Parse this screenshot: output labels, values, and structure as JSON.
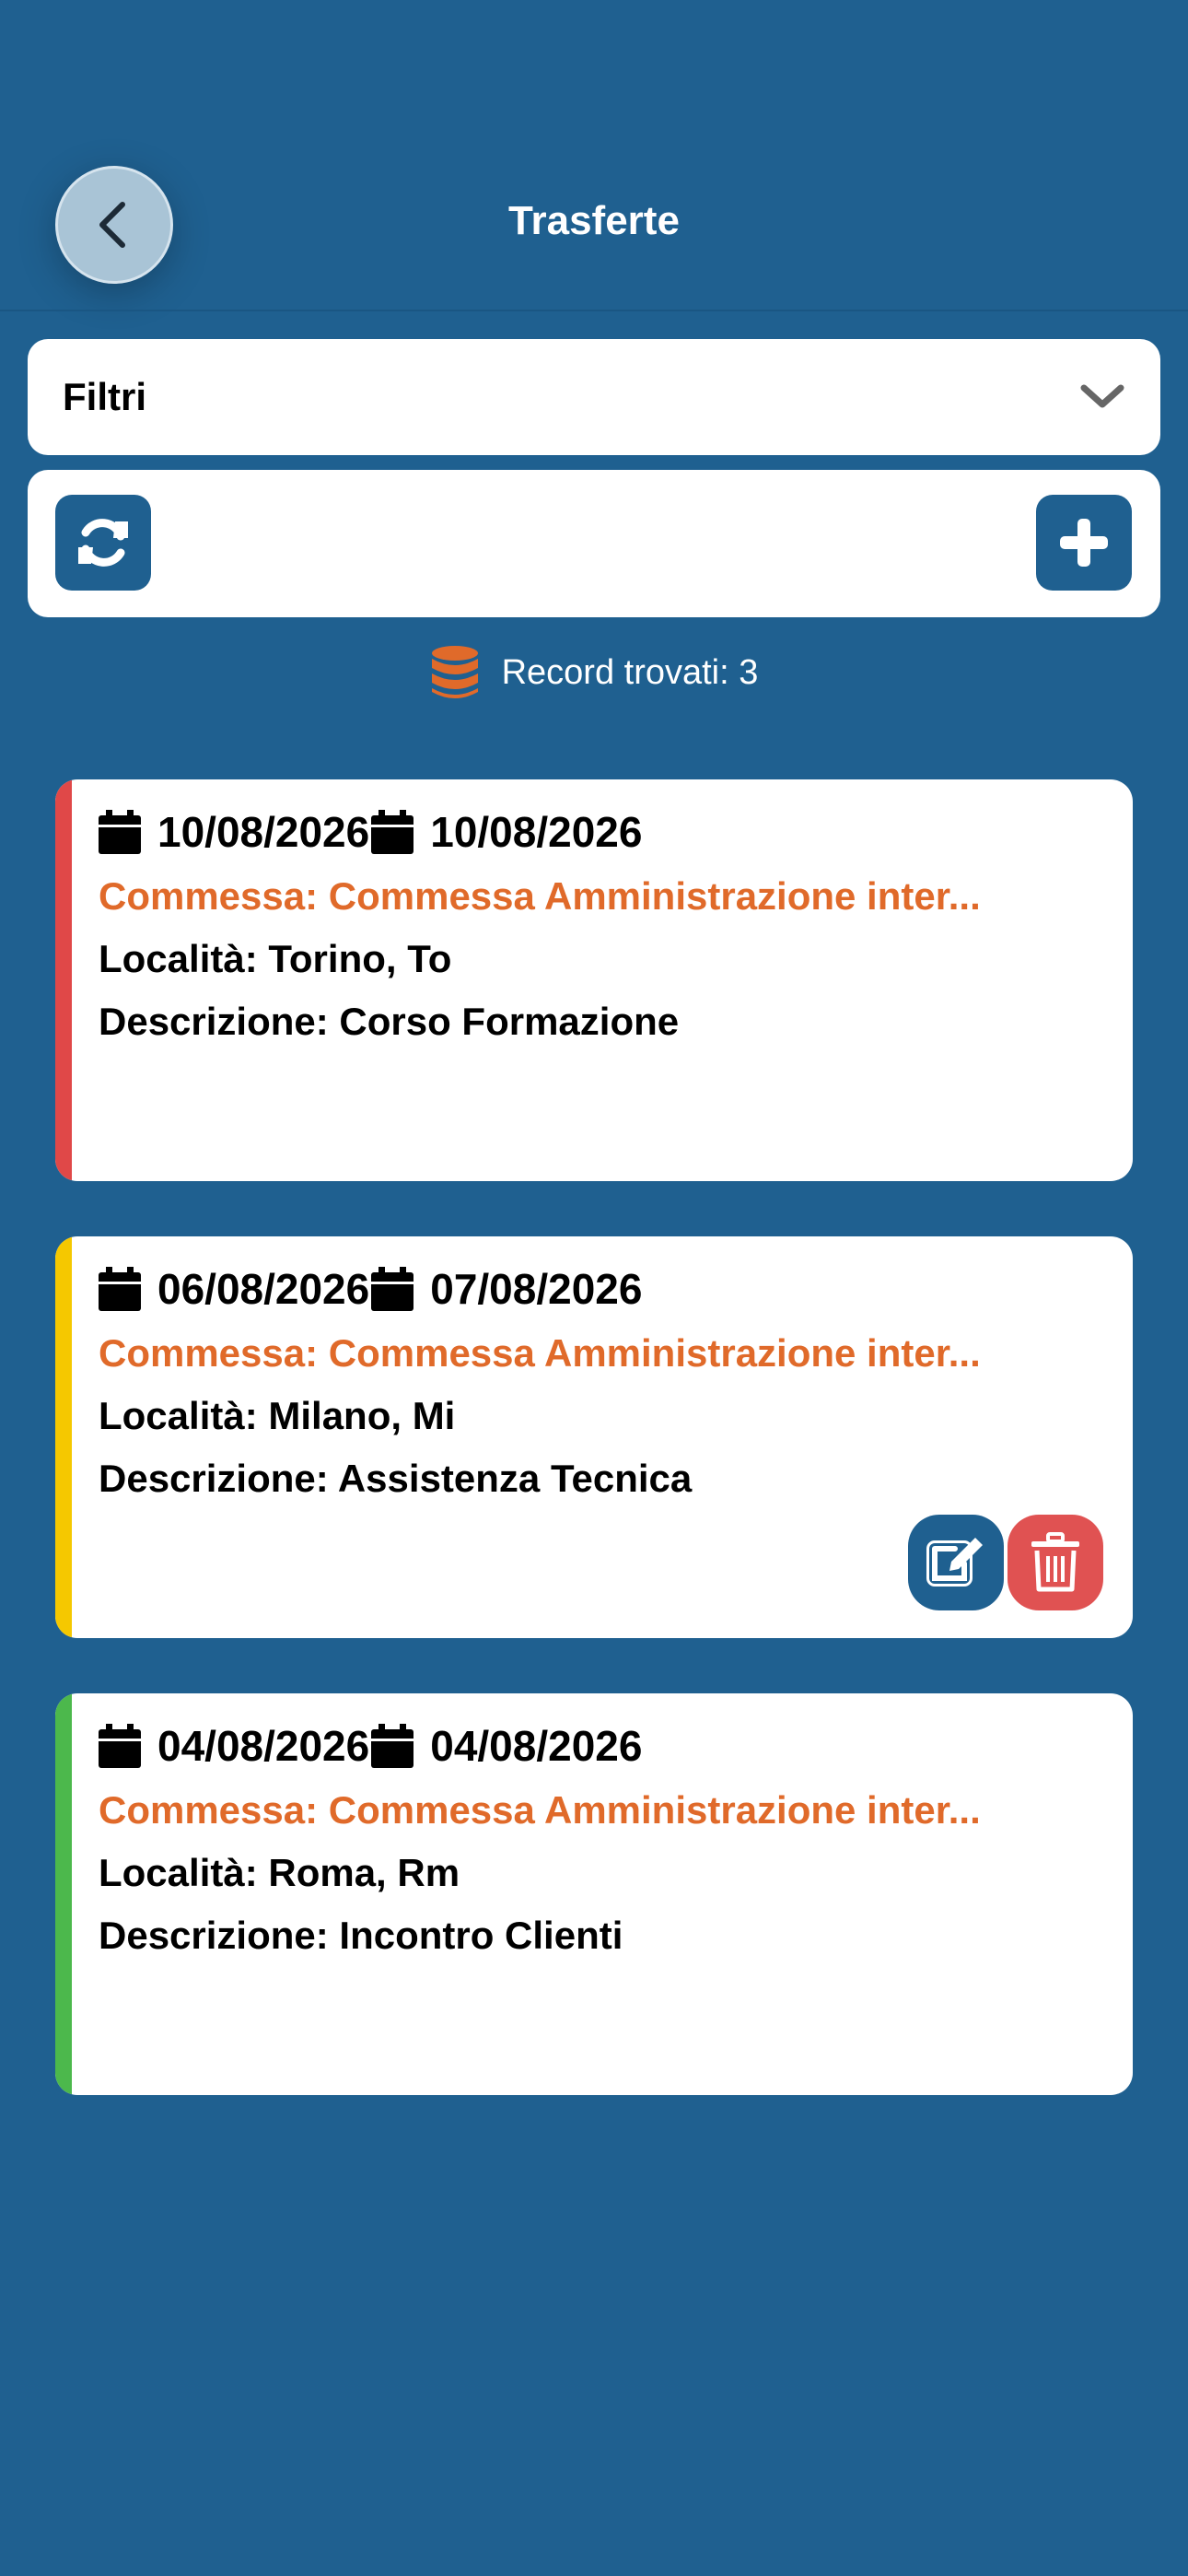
{
  "header": {
    "title": "Trasferte",
    "back_icon": "chevron-left-icon"
  },
  "filters": {
    "label": "Filtri",
    "icon": "chevron-down-icon"
  },
  "toolbar": {
    "refresh_icon": "refresh-icon",
    "add_icon": "plus-icon"
  },
  "records": {
    "icon": "database-icon",
    "label": "Record trovati: 3"
  },
  "colors": {
    "background": "#1f6090",
    "accent": "#e06a2a",
    "delete": "#e05252"
  },
  "trips": [
    {
      "date_from": "10/08/2026",
      "date_to": "10/08/2026",
      "commessa": "Commessa: Commessa Amministrazione inter...",
      "localita": "Località: Torino, To",
      "descrizione": "Descrizione: Corso Formazione",
      "status_color": "#e04848",
      "show_actions": false
    },
    {
      "date_from": "06/08/2026",
      "date_to": "07/08/2026",
      "commessa": "Commessa: Commessa Amministrazione inter...",
      "localita": "Località: Milano, Mi",
      "descrizione": "Descrizione: Assistenza Tecnica",
      "status_color": "#f5c800",
      "show_actions": true,
      "edit_icon": "edit-icon",
      "delete_icon": "trash-icon"
    },
    {
      "date_from": "04/08/2026",
      "date_to": "04/08/2026",
      "commessa": "Commessa: Commessa Amministrazione inter...",
      "localita": "Località: Roma, Rm",
      "descrizione": "Descrizione: Incontro Clienti",
      "status_color": "#4cb84c",
      "show_actions": false
    }
  ]
}
